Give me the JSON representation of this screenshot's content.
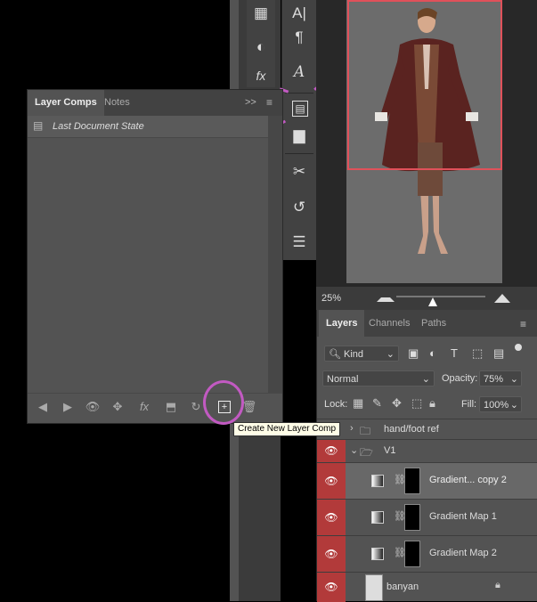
{
  "layer_comps": {
    "tabs": [
      "Layer Comps",
      "Notes"
    ],
    "menu_glyph": ">>",
    "comps": [
      {
        "label": "Last Document State"
      }
    ],
    "bottom_buttons": [
      "previous",
      "next",
      "visibility",
      "position",
      "fx",
      "appearance",
      "update",
      "new",
      "delete"
    ]
  },
  "tooltip": "Create New Layer Comp",
  "zoom": "25%",
  "layers": {
    "tabs": [
      "Layers",
      "Channels",
      "Paths"
    ],
    "filter": "Kind",
    "blend_mode": "Normal",
    "opacity_label": "Opacity:",
    "opacity": "75%",
    "lock_label": "Lock:",
    "fill_label": "Fill:",
    "fill": "100%",
    "items": [
      {
        "name": "hand/foot ref"
      },
      {
        "name": "V1"
      },
      {
        "name": "Gradient... copy 2"
      },
      {
        "name": "Gradient Map 1"
      },
      {
        "name": "Gradient Map 2"
      },
      {
        "name": "banyan"
      }
    ]
  },
  "colors": {
    "accent": "#b23a3a",
    "artboard": "#e0515a",
    "annotation": "#c25ac2"
  }
}
